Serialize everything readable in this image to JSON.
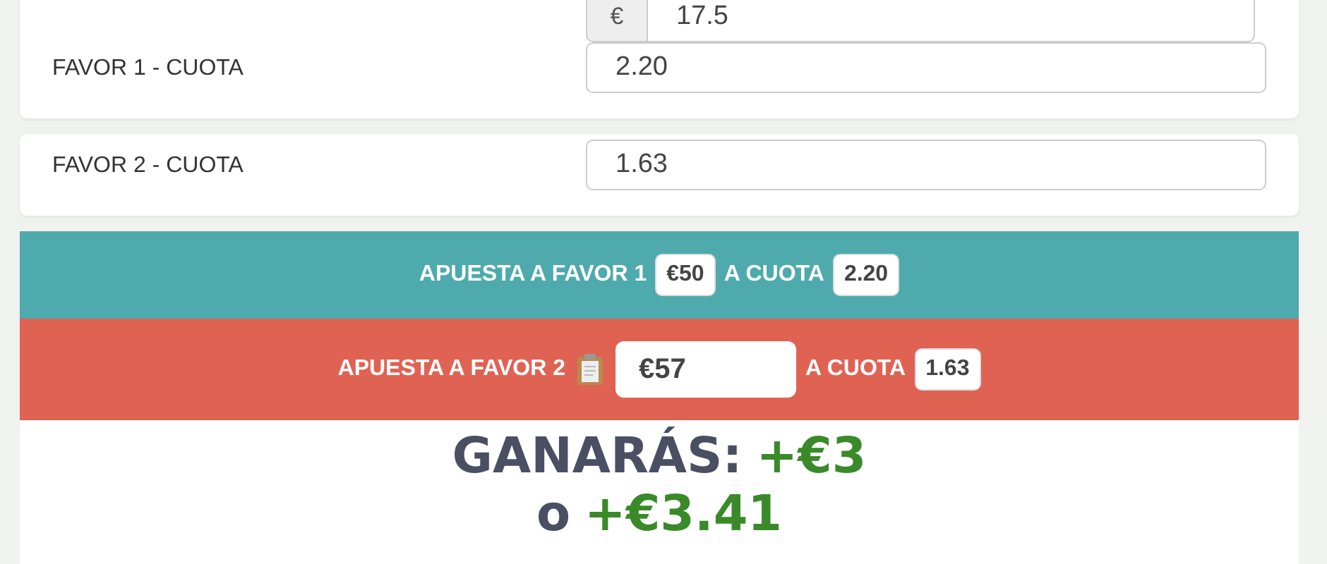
{
  "cards": [
    {
      "rows": [
        {
          "kind": "money",
          "prefix": "€",
          "value": "17.5"
        },
        {
          "kind": "plain",
          "label": "FAVOR 1 - CUOTA",
          "value": "2.20"
        }
      ]
    },
    {
      "rows": [
        {
          "kind": "plain",
          "label": "FAVOR 2 - CUOTA",
          "value": "1.63"
        }
      ]
    }
  ],
  "bets": [
    {
      "kind": "fixed",
      "color": "#4eaaad",
      "label": "APUESTA A FAVOR 1",
      "amount": "€50",
      "odds_label": "A CUOTA",
      "odds": "2.20"
    },
    {
      "kind": "input",
      "color": "#e06253",
      "label": "APUESTA A FAVOR 2",
      "amount": "€57",
      "odds_label": "A CUOTA",
      "odds": "1.63"
    }
  ],
  "result": {
    "label": "GANARÁS:",
    "value": "+€3",
    "alt_prefix": "o",
    "alt_value": "+€3.41"
  }
}
